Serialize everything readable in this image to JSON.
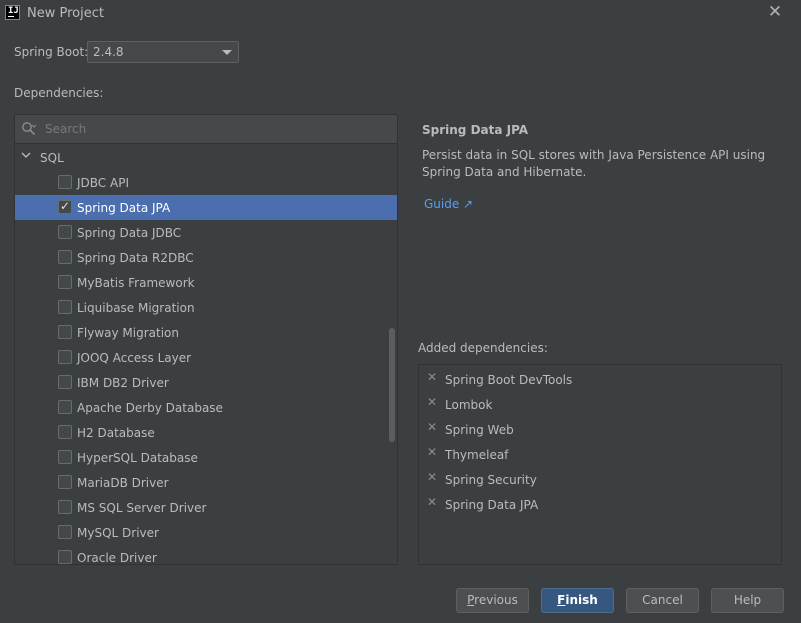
{
  "window": {
    "title": "New Project",
    "icon_text": "IJ"
  },
  "spring_boot": {
    "label": "Spring Boot:",
    "value": "2.4.8"
  },
  "dependencies": {
    "label": "Dependencies:",
    "search_placeholder": "Search",
    "group": {
      "name": "SQL",
      "expanded": true
    },
    "items": [
      {
        "label": "JDBC API",
        "checked": false,
        "selected": false
      },
      {
        "label": "Spring Data JPA",
        "checked": true,
        "selected": true
      },
      {
        "label": "Spring Data JDBC",
        "checked": false,
        "selected": false
      },
      {
        "label": "Spring Data R2DBC",
        "checked": false,
        "selected": false
      },
      {
        "label": "MyBatis Framework",
        "checked": false,
        "selected": false
      },
      {
        "label": "Liquibase Migration",
        "checked": false,
        "selected": false
      },
      {
        "label": "Flyway Migration",
        "checked": false,
        "selected": false
      },
      {
        "label": "JOOQ Access Layer",
        "checked": false,
        "selected": false
      },
      {
        "label": "IBM DB2 Driver",
        "checked": false,
        "selected": false
      },
      {
        "label": "Apache Derby Database",
        "checked": false,
        "selected": false
      },
      {
        "label": "H2 Database",
        "checked": false,
        "selected": false
      },
      {
        "label": "HyperSQL Database",
        "checked": false,
        "selected": false
      },
      {
        "label": "MariaDB Driver",
        "checked": false,
        "selected": false
      },
      {
        "label": "MS SQL Server Driver",
        "checked": false,
        "selected": false
      },
      {
        "label": "MySQL Driver",
        "checked": false,
        "selected": false
      },
      {
        "label": "Oracle Driver",
        "checked": false,
        "selected": false
      }
    ]
  },
  "detail": {
    "title": "Spring Data JPA",
    "description": "Persist data in SQL stores with Java Persistence API using Spring Data and Hibernate.",
    "guide_label": "Guide ↗"
  },
  "added": {
    "label": "Added dependencies:",
    "items": [
      "Spring Boot DevTools",
      "Lombok",
      "Spring Web",
      "Thymeleaf",
      "Spring Security",
      "Spring Data JPA"
    ]
  },
  "buttons": {
    "previous": {
      "mnemonic": "P",
      "rest": "revious"
    },
    "finish": {
      "mnemonic": "F",
      "rest": "inish"
    },
    "cancel": "Cancel",
    "help": "Help"
  },
  "colors": {
    "selection": "#4b6eaf",
    "link": "#589df6",
    "primary_button": "#365880",
    "background": "#3c3f41"
  }
}
